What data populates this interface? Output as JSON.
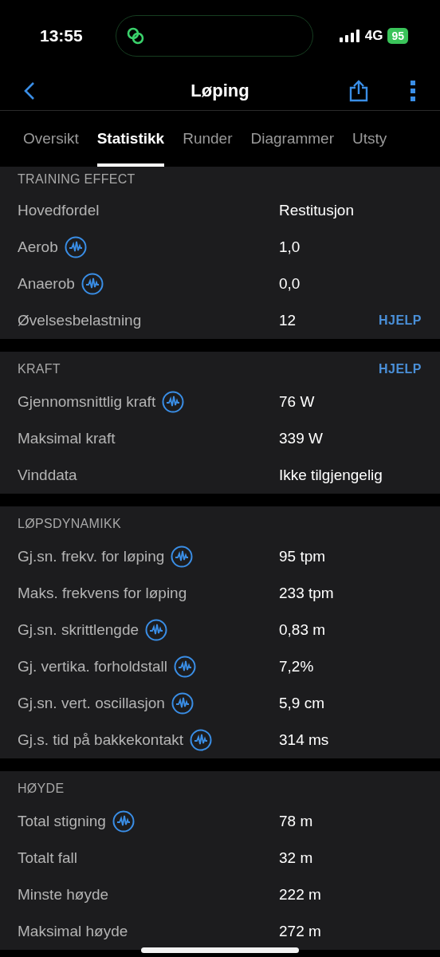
{
  "status_bar": {
    "time": "13:55",
    "network": "4G",
    "battery": "95"
  },
  "nav": {
    "title": "Løping"
  },
  "tabs": [
    {
      "label": "Oversikt",
      "selected": false
    },
    {
      "label": "Statistikk",
      "selected": true
    },
    {
      "label": "Runder",
      "selected": false
    },
    {
      "label": "Diagrammer",
      "selected": false
    },
    {
      "label": "Utsty",
      "selected": false
    }
  ],
  "sections": [
    {
      "title": "TRAINING EFFECT",
      "rows": [
        {
          "label": "Hovedfordel",
          "value": "Restitusjon",
          "chart_icon": false
        },
        {
          "label": "Aerob",
          "value": "1,0",
          "chart_icon": true
        },
        {
          "label": "Anaerob",
          "value": "0,0",
          "chart_icon": true
        },
        {
          "label": "Øvelsesbelastning",
          "value": "12",
          "chart_icon": false,
          "action": "HJELP"
        }
      ]
    },
    {
      "title": "KRAFT",
      "action": "HJELP",
      "rows": [
        {
          "label": "Gjennomsnittlig kraft",
          "value": "76 W",
          "chart_icon": true
        },
        {
          "label": "Maksimal kraft",
          "value": "339 W",
          "chart_icon": false
        },
        {
          "label": "Vinddata",
          "value": "Ikke tilgjengelig",
          "chart_icon": false
        }
      ]
    },
    {
      "title": "LØPSDYNAMIKK",
      "rows": [
        {
          "label": "Gj.sn. frekv. for løping",
          "value": "95 tpm",
          "chart_icon": true
        },
        {
          "label": "Maks. frekvens for løping",
          "value": "233 tpm",
          "chart_icon": false
        },
        {
          "label": "Gj.sn. skrittlengde",
          "value": "0,83 m",
          "chart_icon": true
        },
        {
          "label": "Gj. vertika. forholdstall",
          "value": "7,2%",
          "chart_icon": true
        },
        {
          "label": "Gj.sn. vert. oscillasjon",
          "value": "5,9 cm",
          "chart_icon": true
        },
        {
          "label": "Gj.s. tid på bakkekontakt",
          "value": "314 ms",
          "chart_icon": true
        }
      ]
    },
    {
      "title": "HØYDE",
      "rows": [
        {
          "label": "Total stigning",
          "value": "78 m",
          "chart_icon": true
        },
        {
          "label": "Totalt fall",
          "value": "32 m",
          "chart_icon": false
        },
        {
          "label": "Minste høyde",
          "value": "222 m",
          "chart_icon": false
        },
        {
          "label": "Maksimal høyde",
          "value": "272 m",
          "chart_icon": false
        }
      ]
    }
  ]
}
